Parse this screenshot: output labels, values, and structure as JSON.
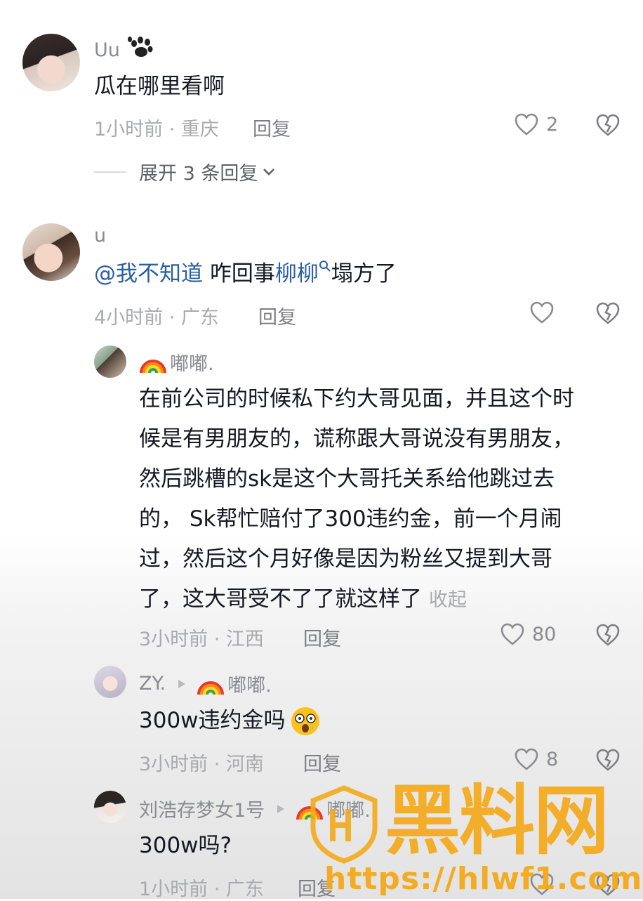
{
  "colors": {
    "text": "#161823",
    "muted": "#a9aaae",
    "name": "#8a8b91",
    "mention": "#2a5ea6",
    "watermark": "#f4a91a"
  },
  "comments": [
    {
      "username": "Uu",
      "name_emoji": "paw-icon",
      "text": "瓜在哪里看啊",
      "time_location": "1小时前 · 重庆",
      "reply_label": "回复",
      "likes": "2",
      "expand_label": "展开 3 条回复"
    },
    {
      "username": "u",
      "mention": "@我不知道",
      "text_before_link": " 咋回事",
      "link_text": "柳柳",
      "text_after_link": "塌方了",
      "time_location": "4小时前 · 广东",
      "reply_label": "回复",
      "likes": ""
    }
  ],
  "replies": [
    {
      "username": "嘟嘟.",
      "name_emoji": "rainbow-icon",
      "lines": [
        "在前公司的时候私下约大哥见面，并且这个时",
        "候是有男朋友的，谎称跟大哥说没有男朋友，",
        "然后跳槽的sk是这个大哥托关系给他跳过去",
        "的， Sk帮忙赔付了300违约金，前一个月闹",
        "过，然后这个月好像是因为粉丝又提到大哥",
        "了，这大哥受不了了就这样了"
      ],
      "collapse_label": "收起",
      "time_location": "3小时前 · 江西",
      "reply_label": "回复",
      "likes": "80"
    },
    {
      "username": "ZY.",
      "reply_to": "嘟嘟.",
      "text": "300w违约金吗",
      "text_emoji": "dizzy-face-icon",
      "time_location": "3小时前 · 河南",
      "reply_label": "回复",
      "likes": "8"
    },
    {
      "username": "刘浩存梦女1号",
      "reply_to": "嘟嘟.",
      "text": "300w吗?",
      "time_location": "1小时前 · 广东",
      "reply_label": "回复",
      "likes": ""
    }
  ],
  "watermark": {
    "title": "黑料网",
    "url": "https://hlwf1.com"
  }
}
